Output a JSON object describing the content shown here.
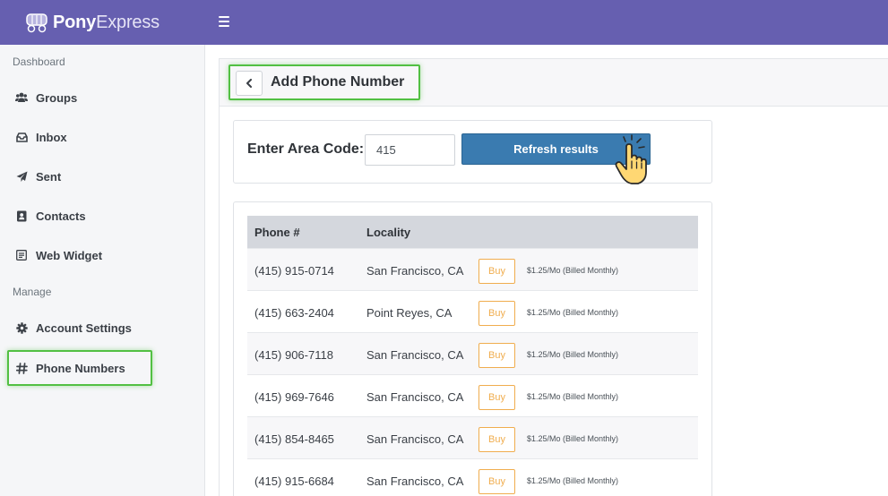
{
  "app": {
    "brand_bold": "Pony",
    "brand_light": "Express"
  },
  "sidebar": {
    "section_dashboard": "Dashboard",
    "section_manage": "Manage",
    "items": [
      {
        "label": "Groups",
        "icon": "users-icon"
      },
      {
        "label": "Inbox",
        "icon": "inbox-icon"
      },
      {
        "label": "Sent",
        "icon": "paper-plane-icon"
      },
      {
        "label": "Contacts",
        "icon": "address-book-icon"
      },
      {
        "label": "Web Widget",
        "icon": "widget-icon"
      },
      {
        "label": "Account Settings",
        "icon": "gear-icon"
      },
      {
        "label": "Phone Numbers",
        "icon": "hash-icon",
        "active": true
      }
    ]
  },
  "page": {
    "title": "Add Phone Number"
  },
  "search": {
    "label": "Enter Area Code:",
    "value": "415",
    "button_label": "Refresh results"
  },
  "table": {
    "headers": [
      "Phone #",
      "Locality"
    ],
    "buy_label": "Buy",
    "rows": [
      {
        "phone": "(415) 915-0714",
        "locality": "San Francisco, CA",
        "price": "$1.25/Mo (Billed Monthly)"
      },
      {
        "phone": "(415) 663-2404",
        "locality": "Point Reyes, CA",
        "price": "$1.25/Mo (Billed Monthly)"
      },
      {
        "phone": "(415) 906-7118",
        "locality": "San Francisco, CA",
        "price": "$1.25/Mo (Billed Monthly)"
      },
      {
        "phone": "(415) 969-7646",
        "locality": "San Francisco, CA",
        "price": "$1.25/Mo (Billed Monthly)"
      },
      {
        "phone": "(415) 854-8465",
        "locality": "San Francisco, CA",
        "price": "$1.25/Mo (Billed Monthly)"
      },
      {
        "phone": "(415) 915-6684",
        "locality": "San Francisco, CA",
        "price": "$1.25/Mo (Billed Monthly)"
      }
    ]
  },
  "colors": {
    "topbar": "#665fb0",
    "primary_button": "#3a7bb0",
    "buy_accent": "#f0ad4e",
    "highlight": "#52c043"
  }
}
